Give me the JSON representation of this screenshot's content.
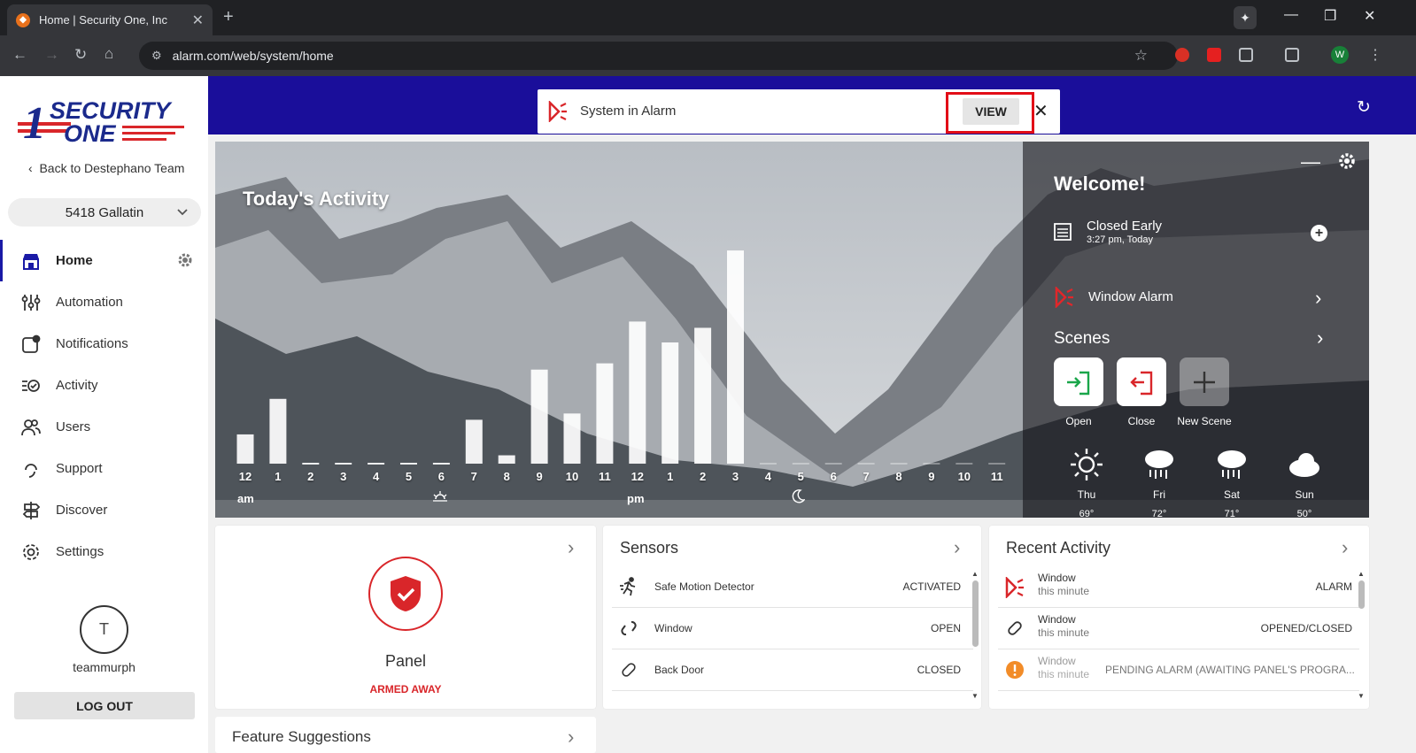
{
  "browser": {
    "tab_title": "Home | Security One, Inc",
    "url": "alarm.com/web/system/home",
    "profile_initial": "W"
  },
  "sidebar": {
    "logo_text": "SECURITY ONE",
    "back_label": "Back to Destephano Team",
    "location": "5418 Gallatin",
    "items": [
      {
        "label": "Home",
        "icon": "storefront-icon"
      },
      {
        "label": "Automation",
        "icon": "sliders-icon"
      },
      {
        "label": "Notifications",
        "icon": "notification-icon"
      },
      {
        "label": "Activity",
        "icon": "activity-check-icon"
      },
      {
        "label": "Users",
        "icon": "users-icon"
      },
      {
        "label": "Support",
        "icon": "headset-icon"
      },
      {
        "label": "Discover",
        "icon": "signpost-icon"
      },
      {
        "label": "Settings",
        "icon": "gear-icon"
      }
    ],
    "user_initial": "T",
    "username": "teammurph",
    "logout_label": "LOG OUT"
  },
  "banner": {
    "message": "System in Alarm",
    "view_label": "VIEW",
    "close": "✕"
  },
  "activity": {
    "title": "Today's Activity",
    "am_label": "am",
    "pm_label": "pm"
  },
  "chart_data": {
    "type": "bar",
    "title": "Today's Activity",
    "categories": [
      "12",
      "1",
      "2",
      "3",
      "4",
      "5",
      "6",
      "7",
      "8",
      "9",
      "10",
      "11",
      "12",
      "1",
      "2",
      "3",
      "4",
      "5",
      "6",
      "7",
      "8",
      "9",
      "10",
      "11"
    ],
    "values": [
      14,
      31,
      0,
      0,
      0,
      0,
      0,
      21,
      4,
      45,
      24,
      48,
      68,
      58,
      65,
      102,
      0,
      0,
      0,
      0,
      0,
      0,
      0,
      0
    ],
    "future_from_index": 16,
    "ylim": [
      0,
      105
    ]
  },
  "welcome": {
    "title": "Welcome!",
    "status": "Closed Early",
    "status_time": "3:27 pm, Today",
    "alarm_label": "Window Alarm",
    "scenes_title": "Scenes",
    "scenes": [
      {
        "label": "Open",
        "color": "#1aa64a"
      },
      {
        "label": "Close",
        "color": "#d9262a"
      },
      {
        "label": "New Scene",
        "color": "#333333"
      }
    ],
    "weather": [
      {
        "day": "Thu",
        "temp": "69°",
        "icon": "sun-icon"
      },
      {
        "day": "Fri",
        "temp": "72°",
        "icon": "rain-cloud-icon"
      },
      {
        "day": "Sat",
        "temp": "71°",
        "icon": "rain-cloud-icon"
      },
      {
        "day": "Sun",
        "temp": "50°",
        "icon": "cloud-icon"
      }
    ]
  },
  "panel_card": {
    "label": "Panel",
    "status": "ARMED AWAY",
    "status_color": "#d9262a"
  },
  "sensors_card": {
    "title": "Sensors",
    "rows": [
      {
        "name": "Safe Motion Detector",
        "state": "ACTIVATED",
        "icon": "running-person-icon"
      },
      {
        "name": "Window",
        "state": "OPEN",
        "icon": "open-link-icon"
      },
      {
        "name": "Back Door",
        "state": "CLOSED",
        "icon": "closed-link-icon"
      }
    ]
  },
  "recent_card": {
    "title": "Recent Activity",
    "rows": [
      {
        "name": "Window",
        "time": "this minute",
        "event": "ALARM",
        "icon": "alarm-siren-icon"
      },
      {
        "name": "Window",
        "time": "this minute",
        "event": "OPENED/CLOSED",
        "icon": "closed-link-icon"
      },
      {
        "name": "Window",
        "time": "this minute",
        "event": "PENDING ALARM (AWAITING PANEL'S PROGRA...",
        "icon": "warning-circle-icon"
      }
    ]
  },
  "feature_card": {
    "title": "Feature Suggestions"
  }
}
